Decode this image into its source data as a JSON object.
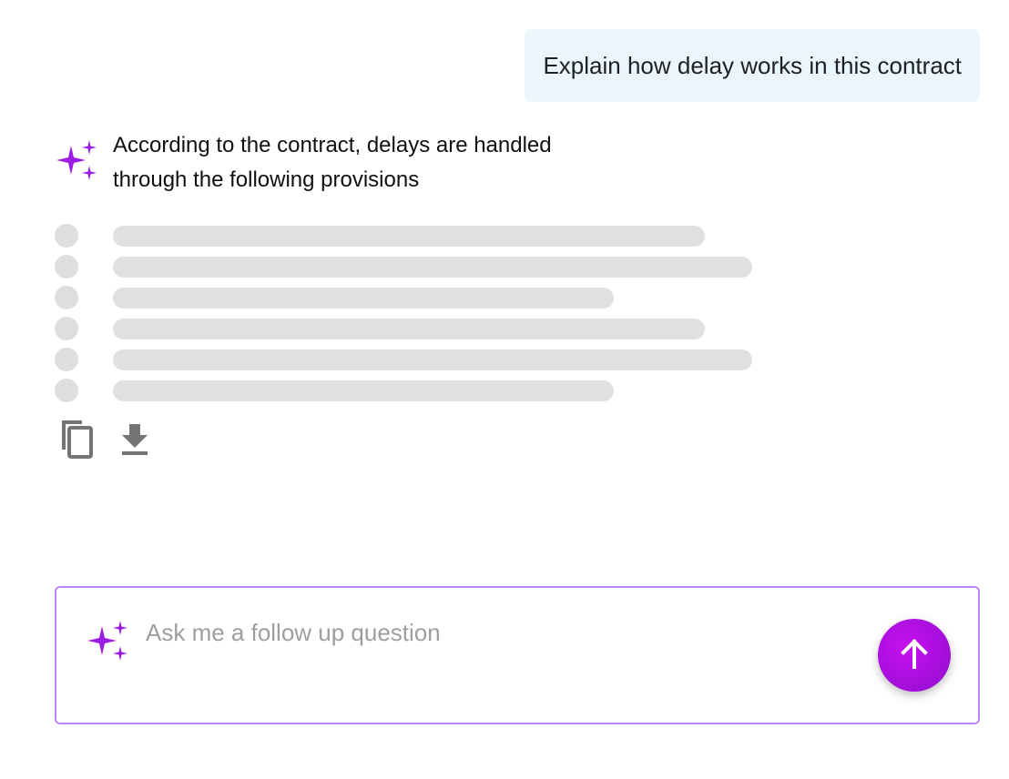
{
  "conversation": {
    "user_message": "Explain how delay works in this contract",
    "assistant_message_line1": "According to the contract, delays are handled",
    "assistant_message_line2": "through the following provisions"
  },
  "icons": {
    "assistant": "sparkle-icon",
    "copy": "copy-icon",
    "download": "download-icon",
    "composer": "sparkle-icon",
    "send": "arrow-up-icon"
  },
  "composer": {
    "placeholder": "Ask me a follow up question",
    "value": ""
  },
  "colors": {
    "accent": "#a10ed8",
    "sparkle": "#9c1ee6",
    "user_bubble": "#eaf5fc",
    "composer_border": "#b586f5",
    "skeleton": "#e0e0e0"
  }
}
